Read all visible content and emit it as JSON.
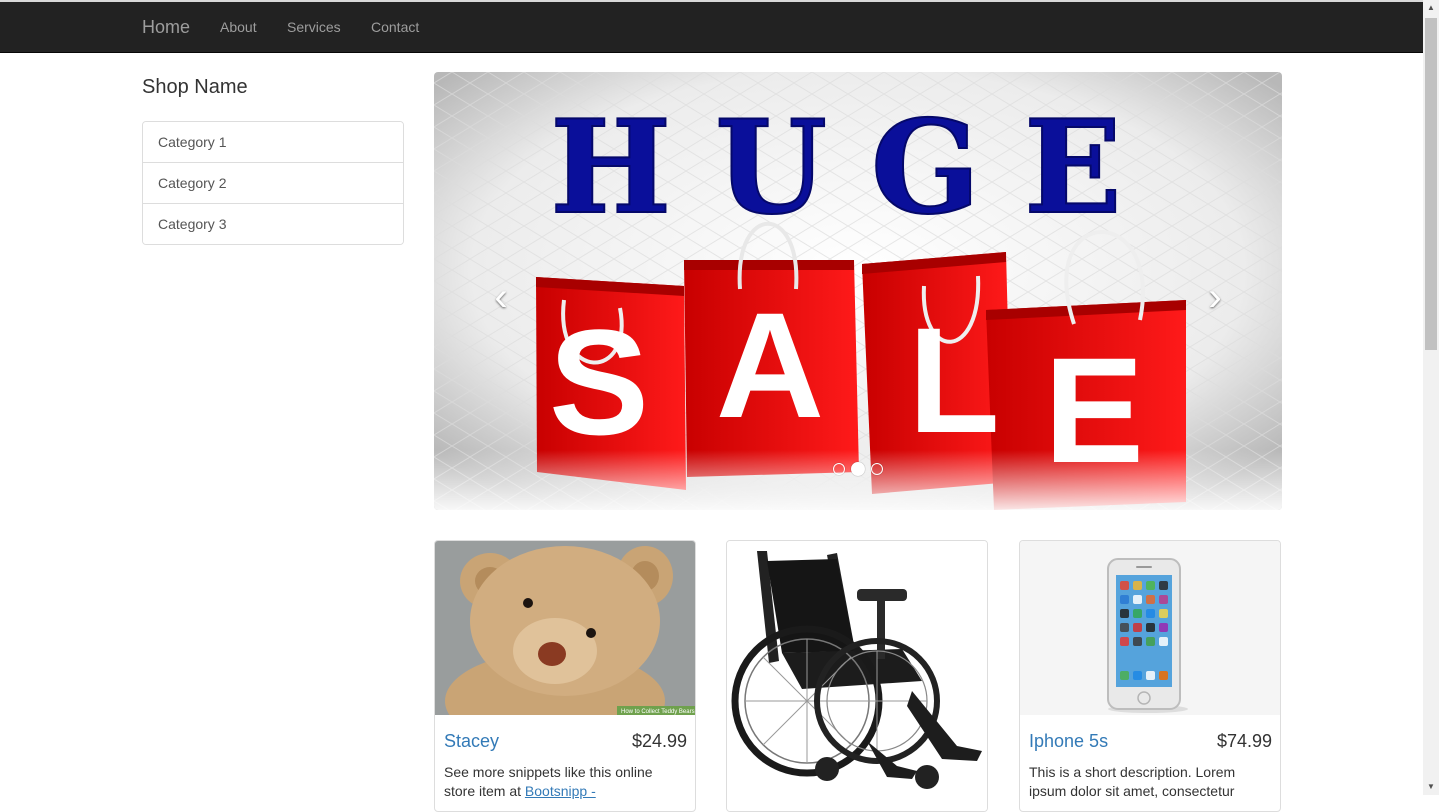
{
  "nav": {
    "brand": "Home",
    "links": [
      "About",
      "Services",
      "Contact"
    ]
  },
  "sidebar": {
    "shop_name": "Shop Name",
    "categories": [
      "Category 1",
      "Category 2",
      "Category 3"
    ]
  },
  "carousel": {
    "slide_text_top": "HUGE",
    "slide_letters": [
      "S",
      "A",
      "L",
      "E"
    ],
    "prev_icon": "‹",
    "next_icon": "›",
    "slide_count": 3,
    "active_slide": 2
  },
  "products": [
    {
      "title": "Stacey",
      "price": "$24.99",
      "desc_text": "See more snippets like this online store item at ",
      "desc_link": "Bootsnipp -",
      "image": "teddy-bear",
      "watermark": "How to Collect Teddy Bears"
    },
    {
      "title": "",
      "price": "",
      "desc_text": "",
      "desc_link": "",
      "image": "wheelchair"
    },
    {
      "title": "Iphone 5s",
      "price": "$74.99",
      "desc_text": "This is a short description. Lorem ipsum dolor sit amet, consectetur",
      "desc_link": "",
      "image": "iphone"
    }
  ],
  "colors": {
    "navbar": "#222222",
    "nav_text": "#9d9d9d",
    "link": "#337ab7",
    "huge_blue": "#0a0f9a",
    "bag_red": "#e10b0b"
  }
}
